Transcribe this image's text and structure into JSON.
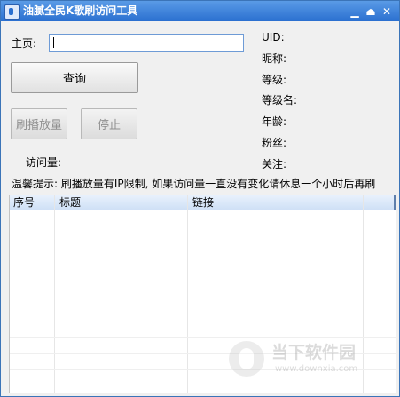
{
  "window": {
    "title": "油腻全民K歌刷访问工具",
    "min_symbol": "▁",
    "restore_symbol": "⏏",
    "close_symbol": "✕"
  },
  "form": {
    "homepage_label": "主页:",
    "homepage_value": "",
    "query_button": "查询",
    "brush_button": "刷播放量",
    "stop_button": "停止",
    "visits_label": "访问量:"
  },
  "info": {
    "uid_label": "UID:",
    "nickname_label": "昵称:",
    "level_label": "等级:",
    "level_name_label": "等级名:",
    "age_label": "年龄:",
    "fans_label": "粉丝:",
    "follow_label": "关注:"
  },
  "tip": "温馨提示: 刷播放量有IP限制, 如果访问量一直没有变化请休息一个小时后再刷",
  "table": {
    "columns": [
      "序号",
      "标题",
      "链接"
    ],
    "rows": []
  },
  "watermark": {
    "text": "当下软件园",
    "url": "www.downxia.com"
  }
}
